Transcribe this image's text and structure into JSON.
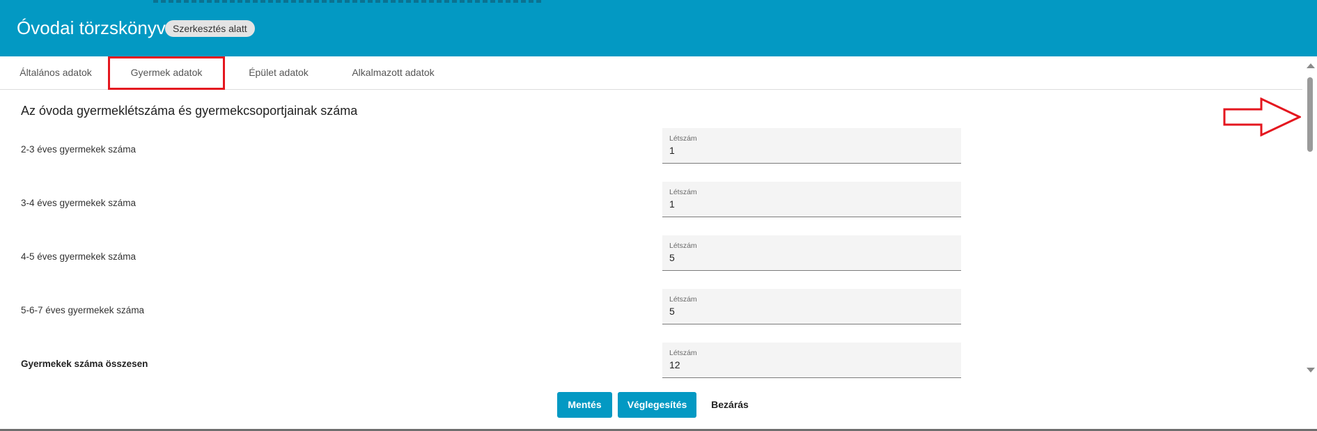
{
  "header": {
    "title": "Óvodai törzskönyv",
    "status_badge": "Szerkesztés alatt"
  },
  "tabs": [
    {
      "label": "Általános adatok",
      "active": false
    },
    {
      "label": "Gyermek adatok",
      "active": true
    },
    {
      "label": "Épület adatok",
      "active": false
    },
    {
      "label": "Alkalmazott adatok",
      "active": false
    }
  ],
  "section": {
    "title": "Az óvoda gyermeklétszáma és gyermekcsoportjainak száma",
    "rows": [
      {
        "label": "2-3 éves gyermekek száma",
        "field_label": "Létszám",
        "value": "1"
      },
      {
        "label": "3-4 éves gyermekek száma",
        "field_label": "Létszám",
        "value": "1"
      },
      {
        "label": "4-5 éves gyermekek száma",
        "field_label": "Létszám",
        "value": "5"
      },
      {
        "label": "5-6-7 éves gyermekek száma",
        "field_label": "Létszám",
        "value": "5"
      },
      {
        "label": "Gyermekek száma összesen",
        "field_label": "Létszám",
        "value": "12"
      }
    ]
  },
  "footer": {
    "save_label": "Mentés",
    "finalize_label": "Véglegesítés",
    "close_label": "Bezárás"
  },
  "colors": {
    "header_bg": "#0399c3",
    "primary_button": "#0399c3",
    "annotation_red": "#e4171f"
  }
}
